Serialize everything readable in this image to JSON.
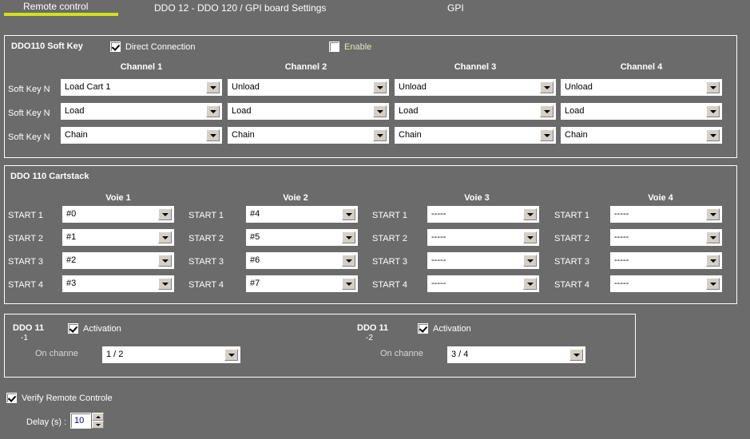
{
  "header": {
    "tab_label": "Remote control",
    "title": "DDO 12 - DDO 120 / GPI board Settings",
    "right_label": "GPI",
    "accent_color": "#d2e01f",
    "background_color": "#6b6b6b"
  },
  "softkey_group": {
    "title": "DDO110 Soft Key",
    "direct_connection": {
      "label": "Direct Connection",
      "checked": true
    },
    "enable": {
      "label": "Enable",
      "checked": false
    },
    "column_headers": [
      "Channel 1",
      "Channel 2",
      "Channel 3",
      "Channel 4"
    ],
    "rows": [
      {
        "label": "Soft Key N",
        "values": [
          "Load Cart 1",
          "Unload",
          "Unload",
          "Unload"
        ]
      },
      {
        "label": "Soft Key N",
        "values": [
          "Load",
          "Load",
          "Load",
          "Load"
        ]
      },
      {
        "label": "Soft Key N",
        "values": [
          "Chain",
          "Chain",
          "Chain",
          "Chain"
        ]
      }
    ]
  },
  "cartstack_group": {
    "title": "DDO 110 Cartstack",
    "column_headers": [
      "Voie 1",
      "Voie 2",
      "Voie 3",
      "Voie 4"
    ],
    "row_labels": [
      "START 1",
      "START 2",
      "START 3",
      "START 4"
    ],
    "columns": [
      [
        "#0",
        "#1",
        "#2",
        "#3"
      ],
      [
        "#4",
        "#5",
        "#6",
        "#7"
      ],
      [
        "-----",
        "-----",
        "-----",
        "-----"
      ],
      [
        "-----",
        "-----",
        "-----",
        "-----"
      ]
    ]
  },
  "ddo11_group": {
    "panels": [
      {
        "title": "DDO 11",
        "subtitle": "-1",
        "activation": {
          "label": "Activation",
          "checked": true
        },
        "channel_label": "On channe",
        "channel_value": "1 / 2"
      },
      {
        "title": "DDO 11",
        "subtitle": "-2",
        "activation": {
          "label": "Activation",
          "checked": true
        },
        "channel_label": "On channe",
        "channel_value": "3 / 4"
      }
    ]
  },
  "footer": {
    "verify": {
      "label": "Verify Remote Controle",
      "checked": true
    },
    "delay_label": "Delay (s) :",
    "delay_value": "10"
  }
}
